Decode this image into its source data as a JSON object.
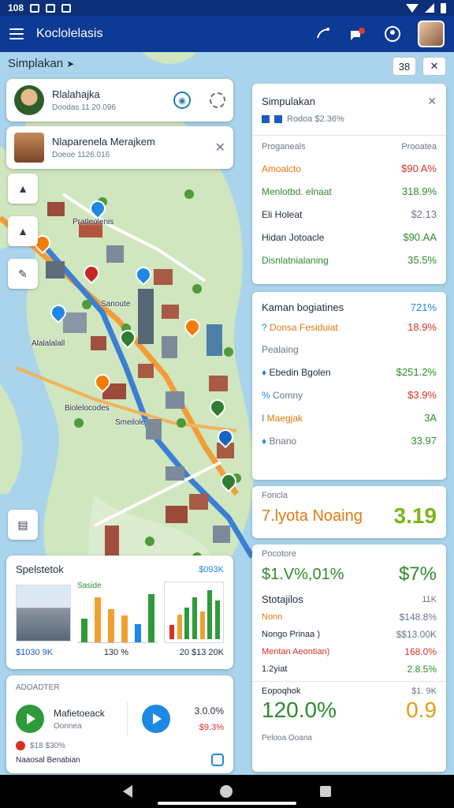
{
  "status_bar": {
    "time": "108"
  },
  "app_bar": {
    "title": "Koclolelasis"
  },
  "sim_label": "Simplakan",
  "map_buttons": {
    "grid": "38",
    "close": "✕"
  },
  "location_cards": [
    {
      "title": "Rlalahajka",
      "subtitle": "Doodas 11 20.096"
    },
    {
      "title": "Nlaparenela Merajkem",
      "subtitle": "Doeoe 1126.016"
    }
  ],
  "map_labels": [
    "Pratleolenis",
    "Sanoute",
    "Alalalalall",
    "Biolelocodes",
    "Smeilole"
  ],
  "summary_panel": {
    "title": "Simpulakan",
    "subtitle": "Rodoa $2.36%",
    "col_left": "Proganeals",
    "col_right": "Prooatea",
    "rows": [
      {
        "label": "Amoalcto",
        "value": "$90 A%",
        "label_color": "#e07a10",
        "value_color": "#d93025"
      },
      {
        "label": "Menlotbd. elnaat",
        "value": "318.9%",
        "label_color": "#2e8b2e",
        "value_color": "#2e8b2e"
      },
      {
        "label": "Eli Holeat",
        "value": "$2.13",
        "label_color": "#1e2a3a",
        "value_color": "#6b7685"
      },
      {
        "label": "Hidan Jotoacle",
        "value": "$90.AA",
        "label_color": "#1e2a3a",
        "value_color": "#2e8b2e"
      },
      {
        "label": "Disnlatnialaning",
        "value": "35.5%",
        "label_color": "#2e8b2e",
        "value_color": "#2e8b2e"
      }
    ]
  },
  "kpi_panel": {
    "title": "Kaman bogiatines",
    "title_value": "721%",
    "rows": [
      {
        "label": "Donsa Fesiduiat",
        "value": "18.9%",
        "label_color": "#e07a10",
        "value_color": "#d93025",
        "icon": "?"
      },
      {
        "label": "Pealaing",
        "value": "",
        "label_color": "#6b7685",
        "value_color": "#1e2a3a",
        "icon": ""
      },
      {
        "label": "Ebedin Bgolen",
        "value": "$251.2%",
        "label_color": "#1e2a3a",
        "value_color": "#2e8b2e",
        "icon": "♦"
      },
      {
        "label": "Comny",
        "value": "$3.9%",
        "label_color": "#6b7685",
        "value_color": "#d93025",
        "icon": "%"
      },
      {
        "label": "Maegjak",
        "value": "3A",
        "label_color": "#e07a10",
        "value_color": "#2e8b2e",
        "icon": "I"
      },
      {
        "label": "Bnano",
        "value": "33.97",
        "label_color": "#6b7685",
        "value_color": "#2e8b2e",
        "icon": "♦"
      }
    ]
  },
  "metric_panel": {
    "caption": "Foncla",
    "label": "7.lyota Noaing",
    "value": "3.19"
  },
  "finance_panel": {
    "caption": "Pocotore",
    "big_left": "$1.V%,01%",
    "big_right": "$7%",
    "section": "Stotajilos",
    "section_value": "11K",
    "rows": [
      {
        "label": "Nonn",
        "value": "$148.8%",
        "label_color": "#e07a10",
        "value_color": "#6b7685"
      },
      {
        "label": "Nongo Prinaa )",
        "value": "$$13.00K",
        "label_color": "#1e2a3a",
        "value_color": "#6b7685"
      },
      {
        "label": "Mentan Aeontian)",
        "value": "168.0%",
        "label_color": "#d93025",
        "value_color": "#d93025"
      },
      {
        "label": "1.2yiat",
        "value": "2.8.5%",
        "label_color": "#1e2a3a",
        "value_color": "#2e8b2e"
      }
    ],
    "footer_label": "Eopoqhok",
    "footer_label_value": "$1. 9K",
    "footer_big_left": "120.0%",
    "footer_big_right": "0.9",
    "bottom_caption": "Pelooa Ooana"
  },
  "chart_card": {
    "title": "Spelstetok",
    "title_value": "$093K",
    "mini_title": "Saside",
    "footer": [
      "$1030 9K",
      "130 %",
      "20 $13 20K"
    ],
    "chart_data": [
      {
        "type": "bar",
        "values": [
          40,
          75,
          55,
          45,
          30,
          80
        ]
      },
      {
        "type": "bar",
        "values": [
          20,
          35,
          45,
          60,
          40,
          70,
          55
        ]
      }
    ]
  },
  "progress_card": {
    "caption": "ADOADTER",
    "item_title": "Mafietoeack",
    "item_sub": "Oonnea",
    "item_meta": "$18 $30%",
    "footer_label": "Naaosal Benabian",
    "right_value": "3.0.0%",
    "right_value2": "$9.3%"
  },
  "colors": {
    "accent": "#0d3a94",
    "green": "#2e8b2e",
    "orange": "#e07a10",
    "red": "#d93025",
    "water": "#a9d4ec",
    "land": "#cfe6bf"
  }
}
